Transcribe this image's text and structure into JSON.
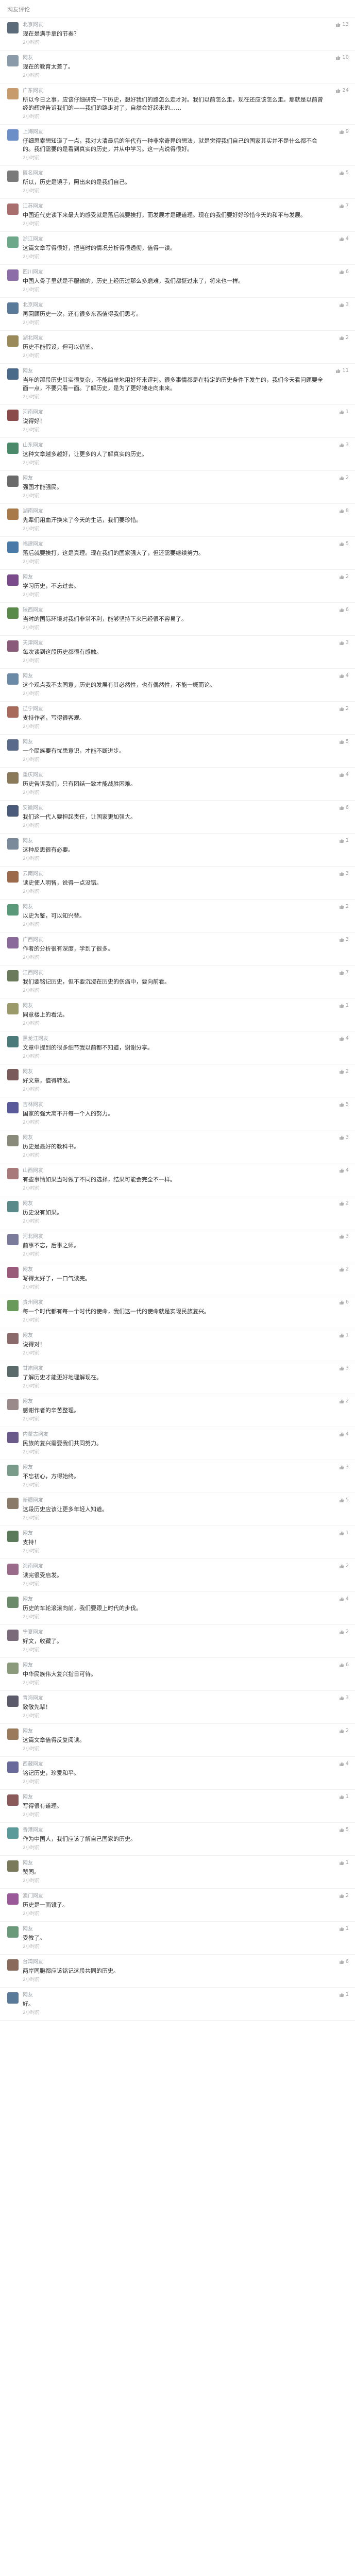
{
  "header": {
    "title": "网友评论"
  },
  "comments": [
    {
      "user": "北京网友",
      "text": "现在是满手拿的节奏？",
      "time": "2小时前",
      "likes": "13",
      "avatar_color": "#5c6b7a"
    },
    {
      "user": "网友",
      "text": "现在的教育太差了。",
      "time": "2小时前",
      "likes": "10",
      "avatar_color": "#8a9aa8"
    },
    {
      "user": "广东网友",
      "text": "所以今日之事，应该仔细研究一下历史，想好我们的路怎么走才对。我们以前怎么走，现在还应该怎么走。那就是以前曾经的辉煌告诉我们的——我们的路走对了，自然会好起来的……",
      "time": "2小时前",
      "likes": "24",
      "avatar_color": "#c89b6d"
    },
    {
      "user": "上海网友",
      "text": "仔细思索想知道了一点，我对大清最后的年代有一种非常奇异的想法，就是觉得我们自己的国家其实并不是什么都不会的。我们需要的是看到真实的历史，并从中学习。这一点说得很好。",
      "time": "2小时前",
      "likes": "9",
      "avatar_color": "#6d8fc8"
    },
    {
      "user": "匿名网友",
      "text": "所以，历史是镜子，照出来的是我们自己。",
      "time": "2小时前",
      "likes": "5",
      "avatar_color": "#7a7a7a"
    },
    {
      "user": "江苏网友",
      "text": "中国近代史读下来最大的感受就是落后就要挨打，而发展才是硬道理。现在的我们要好好珍惜今天的和平与发展。",
      "time": "2小时前",
      "likes": "7",
      "avatar_color": "#a86d6d"
    },
    {
      "user": "浙江网友",
      "text": "这篇文章写得很好，把当时的情况分析得很透彻，值得一读。",
      "time": "2小时前",
      "likes": "4",
      "avatar_color": "#6da88a"
    },
    {
      "user": "四川网友",
      "text": "中国人骨子里就是不服输的，历史上经历过那么多磨难，我们都挺过来了，将来也一样。",
      "time": "2小时前",
      "likes": "6",
      "avatar_color": "#8c6da8"
    },
    {
      "user": "北京网友",
      "text": "再回顾历史一次，还有很多东西值得我们思考。",
      "time": "2小时前",
      "likes": "3",
      "avatar_color": "#5a7a9a"
    },
    {
      "user": "湖北网友",
      "text": "历史不能假设，但可以借鉴。",
      "time": "2小时前",
      "likes": "2",
      "avatar_color": "#9a8a5a"
    },
    {
      "user": "网友",
      "text": "当年的那段历史其实很复杂，不能简单地用好坏来评判。很多事情都是在特定的历史条件下发生的，我们今天看问题要全面一点，不要只看一面。了解历史，是为了更好地走向未来。",
      "time": "2小时前",
      "likes": "11",
      "avatar_color": "#4a6a8a"
    },
    {
      "user": "河南网友",
      "text": "说得好！",
      "time": "2小时前",
      "likes": "1",
      "avatar_color": "#8a4a4a"
    },
    {
      "user": "山东网友",
      "text": "这种文章越多越好，让更多的人了解真实的历史。",
      "time": "2小时前",
      "likes": "3",
      "avatar_color": "#4a8a6a"
    },
    {
      "user": "网友",
      "text": "强国才能强民。",
      "time": "2小时前",
      "likes": "2",
      "avatar_color": "#6a6a6a"
    },
    {
      "user": "湖南网友",
      "text": "先辈们用血汗换来了今天的生活，我们要珍惜。",
      "time": "2小时前",
      "likes": "8",
      "avatar_color": "#a87a4a"
    },
    {
      "user": "福建网友",
      "text": "落后就要挨打，这是真理。现在我们的国家强大了，但还需要继续努力。",
      "time": "2小时前",
      "likes": "5",
      "avatar_color": "#4a7aa8"
    },
    {
      "user": "网友",
      "text": "学习历史，不忘过去。",
      "time": "2小时前",
      "likes": "2",
      "avatar_color": "#7a4a8a"
    },
    {
      "user": "陕西网友",
      "text": "当时的国际环境对我们非常不利，能够坚持下来已经很不容易了。",
      "time": "2小时前",
      "likes": "6",
      "avatar_color": "#5a8a4a"
    },
    {
      "user": "天津网友",
      "text": "每次读到这段历史都很有感触。",
      "time": "2小时前",
      "likes": "3",
      "avatar_color": "#8a5a7a"
    },
    {
      "user": "网友",
      "text": "这个观点我不太同意，历史的发展有其必然性，也有偶然性，不能一概而论。",
      "time": "2小时前",
      "likes": "4",
      "avatar_color": "#6a8aa8"
    },
    {
      "user": "辽宁网友",
      "text": "支持作者，写得很客观。",
      "time": "2小时前",
      "likes": "2",
      "avatar_color": "#a86a5a"
    },
    {
      "user": "网友",
      "text": "一个民族要有忧患意识，才能不断进步。",
      "time": "2小时前",
      "likes": "5",
      "avatar_color": "#5a6a8a"
    },
    {
      "user": "重庆网友",
      "text": "历史告诉我们，只有团结一致才能战胜困难。",
      "time": "2小时前",
      "likes": "4",
      "avatar_color": "#8a7a5a"
    },
    {
      "user": "安徽网友",
      "text": "我们这一代人要担起责任，让国家更加强大。",
      "time": "2小时前",
      "likes": "6",
      "avatar_color": "#4a5a7a"
    },
    {
      "user": "网友",
      "text": "这种反思很有必要。",
      "time": "2小时前",
      "likes": "1",
      "avatar_color": "#7a8a9a"
    },
    {
      "user": "云南网友",
      "text": "读史使人明智，说得一点没错。",
      "time": "2小时前",
      "likes": "3",
      "avatar_color": "#9a6a4a"
    },
    {
      "user": "网友",
      "text": "以史为鉴，可以知兴替。",
      "time": "2小时前",
      "likes": "2",
      "avatar_color": "#5a9a7a"
    },
    {
      "user": "广西网友",
      "text": "作者的分析很有深度，学到了很多。",
      "time": "2小时前",
      "likes": "3",
      "avatar_color": "#8a6a9a"
    },
    {
      "user": "江西网友",
      "text": "我们要铭记历史，但不要沉浸在历史的伤痛中，要向前看。",
      "time": "2小时前",
      "likes": "7",
      "avatar_color": "#6a7a5a"
    },
    {
      "user": "网友",
      "text": "同意楼上的看法。",
      "time": "2小时前",
      "likes": "1",
      "avatar_color": "#9a9a6a"
    },
    {
      "user": "黑龙江网友",
      "text": "文章中提到的很多细节我以前都不知道，谢谢分享。",
      "time": "2小时前",
      "likes": "4",
      "avatar_color": "#4a7a7a"
    },
    {
      "user": "网友",
      "text": "好文章，值得转发。",
      "time": "2小时前",
      "likes": "2",
      "avatar_color": "#7a5a5a"
    },
    {
      "user": "吉林网友",
      "text": "国家的强大离不开每一个人的努力。",
      "time": "2小时前",
      "likes": "5",
      "avatar_color": "#5a5a9a"
    },
    {
      "user": "网友",
      "text": "历史是最好的教科书。",
      "time": "2小时前",
      "likes": "3",
      "avatar_color": "#8a8a7a"
    },
    {
      "user": "山西网友",
      "text": "有些事情如果当时做了不同的选择，结果可能会完全不一样。",
      "time": "2小时前",
      "likes": "4",
      "avatar_color": "#a87a7a"
    },
    {
      "user": "网友",
      "text": "历史没有如果。",
      "time": "2小时前",
      "likes": "2",
      "avatar_color": "#5a8a8a"
    },
    {
      "user": "河北网友",
      "text": "前事不忘，后事之师。",
      "time": "2小时前",
      "likes": "3",
      "avatar_color": "#7a7a9a"
    },
    {
      "user": "网友",
      "text": "写得太好了，一口气读完。",
      "time": "2小时前",
      "likes": "2",
      "avatar_color": "#9a5a7a"
    },
    {
      "user": "贵州网友",
      "text": "每一个时代都有每一个时代的使命，我们这一代的使命就是实现民族复兴。",
      "time": "2小时前",
      "likes": "6",
      "avatar_color": "#6a9a5a"
    },
    {
      "user": "网友",
      "text": "说得对！",
      "time": "2小时前",
      "likes": "1",
      "avatar_color": "#8a6a6a"
    },
    {
      "user": "甘肃网友",
      "text": "了解历史才能更好地理解现在。",
      "time": "2小时前",
      "likes": "3",
      "avatar_color": "#5a6a6a"
    },
    {
      "user": "网友",
      "text": "感谢作者的辛苦整理。",
      "time": "2小时前",
      "likes": "2",
      "avatar_color": "#9a8a8a"
    },
    {
      "user": "内蒙古网友",
      "text": "民族的复兴需要我们共同努力。",
      "time": "2小时前",
      "likes": "4",
      "avatar_color": "#6a5a8a"
    },
    {
      "user": "网友",
      "text": "不忘初心，方得始终。",
      "time": "2小时前",
      "likes": "3",
      "avatar_color": "#7a9a8a"
    },
    {
      "user": "新疆网友",
      "text": "这段历史应该让更多年轻人知道。",
      "time": "2小时前",
      "likes": "5",
      "avatar_color": "#8a7a6a"
    },
    {
      "user": "网友",
      "text": "支持！",
      "time": "2小时前",
      "likes": "1",
      "avatar_color": "#5a7a5a"
    },
    {
      "user": "海南网友",
      "text": "读完很受启发。",
      "time": "2小时前",
      "likes": "2",
      "avatar_color": "#9a6a8a"
    },
    {
      "user": "网友",
      "text": "历史的车轮滚滚向前，我们要跟上时代的步伐。",
      "time": "2小时前",
      "likes": "4",
      "avatar_color": "#6a8a6a"
    },
    {
      "user": "宁夏网友",
      "text": "好文，收藏了。",
      "time": "2小时前",
      "likes": "2",
      "avatar_color": "#7a6a7a"
    },
    {
      "user": "网友",
      "text": "中华民族伟大复兴指日可待。",
      "time": "2小时前",
      "likes": "6",
      "avatar_color": "#8a9a7a"
    },
    {
      "user": "青海网友",
      "text": "致敬先辈！",
      "time": "2小时前",
      "likes": "3",
      "avatar_color": "#5a5a6a"
    },
    {
      "user": "网友",
      "text": "这篇文章值得反复阅读。",
      "time": "2小时前",
      "likes": "2",
      "avatar_color": "#9a7a5a"
    },
    {
      "user": "西藏网友",
      "text": "铭记历史，珍爱和平。",
      "time": "2小时前",
      "likes": "4",
      "avatar_color": "#6a6a9a"
    },
    {
      "user": "网友",
      "text": "写得很有道理。",
      "time": "2小时前",
      "likes": "1",
      "avatar_color": "#8a5a5a"
    },
    {
      "user": "香港网友",
      "text": "作为中国人，我们应该了解自己国家的历史。",
      "time": "2小时前",
      "likes": "5",
      "avatar_color": "#5a9a9a"
    },
    {
      "user": "网友",
      "text": "赞同。",
      "time": "2小时前",
      "likes": "1",
      "avatar_color": "#7a7a5a"
    },
    {
      "user": "澳门网友",
      "text": "历史是一面镜子。",
      "time": "2小时前",
      "likes": "2",
      "avatar_color": "#9a5a9a"
    },
    {
      "user": "网友",
      "text": "受教了。",
      "time": "2小时前",
      "likes": "1",
      "avatar_color": "#6a9a7a"
    },
    {
      "user": "台湾网友",
      "text": "两岸同胞都应该铭记这段共同的历史。",
      "time": "2小时前",
      "likes": "6",
      "avatar_color": "#8a6a5a"
    },
    {
      "user": "网友",
      "text": "好。",
      "time": "2小时前",
      "likes": "1",
      "avatar_color": "#5a7a9a"
    }
  ]
}
